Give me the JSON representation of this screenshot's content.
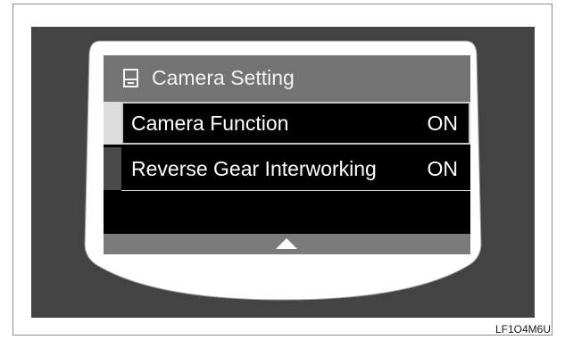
{
  "screen": {
    "title": "Camera Setting",
    "title_icon": "phone-icon",
    "items": [
      {
        "label": "Camera Function",
        "value": "ON"
      },
      {
        "label": "Reverse Gear Interworking",
        "value": "ON"
      }
    ],
    "scroll_indicator_icon": "up-arrow-icon"
  },
  "figure_code": "LF1O4M6U",
  "colors": {
    "background": "#434343",
    "bezel": "#ffffff",
    "header": "#737373",
    "selected_marker": "#dcdcdc"
  }
}
